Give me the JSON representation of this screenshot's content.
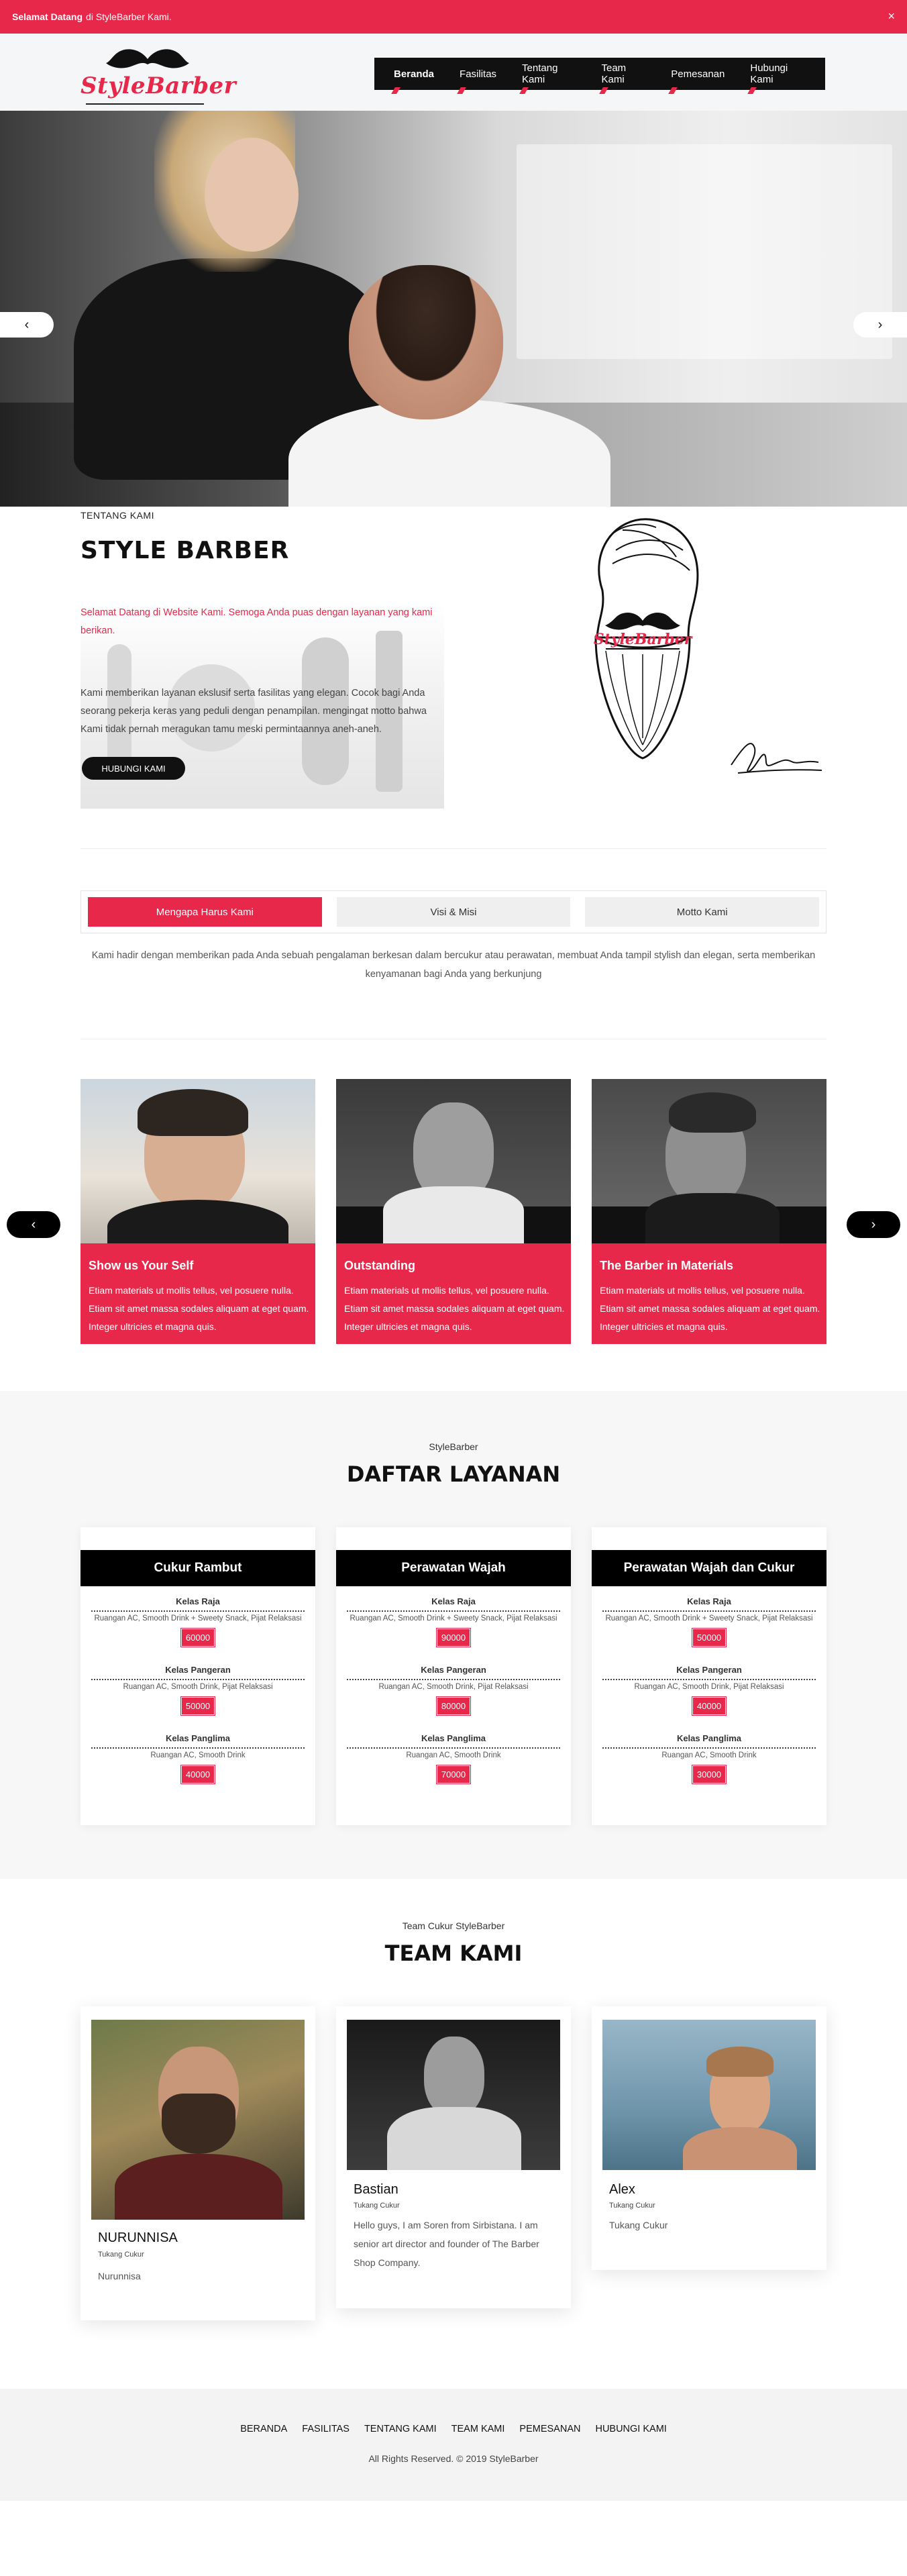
{
  "alert": {
    "strong": "Selamat Datang",
    "text": "di StyleBarber Kami.",
    "close": "×"
  },
  "brand": {
    "name": "StyleBarber"
  },
  "nav": {
    "items": [
      "Beranda",
      "Fasilitas",
      "Tentang Kami",
      "Team Kami",
      "Pemesanan",
      "Hubungi Kami"
    ]
  },
  "hero": {
    "prev": "‹",
    "next": "›"
  },
  "about": {
    "kicker": "TENTANG KAMI",
    "title": "STYLE BARBER",
    "intro": "Selamat Datang di Website Kami. Semoga Anda puas dengan layanan yang kami berikan.",
    "body": "Kami memberikan layanan ekslusif serta fasilitas yang elegan. Cocok bagi Anda seorang pekerja keras yang peduli dengan penampilan. mengingat motto bahwa Kami tidak pernah meragukan tamu meski permintaannya aneh-aneh.",
    "button": "HUBUNGI KAMI",
    "beard_logo": "StyleBarber"
  },
  "tabs": {
    "items": [
      "Mengapa Harus Kami",
      "Visi & Misi",
      "Motto Kami"
    ],
    "active": 0,
    "content": "Kami hadir dengan memberikan pada Anda sebuah pengalaman berkesan dalam bercukur atau perawatan, membuat Anda tampil stylish dan elegan, serta memberikan kenyamanan bagi Anda yang berkunjung"
  },
  "features": {
    "prev": "‹",
    "next": "›",
    "items": [
      {
        "title": "Show us Your Self",
        "text": "Etiam materials ut mollis tellus, vel posuere nulla. Etiam sit amet massa sodales aliquam at eget quam. Integer ultricies et magna quis."
      },
      {
        "title": "Outstanding",
        "text": "Etiam materials ut mollis tellus, vel posuere nulla. Etiam sit amet massa sodales aliquam at eget quam. Integer ultricies et magna quis."
      },
      {
        "title": "The Barber in Materials",
        "text": "Etiam materials ut mollis tellus, vel posuere nulla. Etiam sit amet massa sodales aliquam at eget quam. Integer ultricies et magna quis."
      }
    ]
  },
  "services": {
    "kicker": "StyleBarber",
    "title": "DAFTAR LAYANAN",
    "cards": [
      {
        "title": "Cukur Rambut",
        "tiers": [
          {
            "name": "Kelas Raja",
            "desc": "Ruangan AC, Smooth Drink + Sweety Snack, Pijat Relaksasi",
            "price": "60000"
          },
          {
            "name": "Kelas Pangeran",
            "desc": "Ruangan AC, Smooth Drink, Pijat Relaksasi",
            "price": "50000"
          },
          {
            "name": "Kelas Panglima",
            "desc": "Ruangan AC, Smooth Drink",
            "price": "40000"
          }
        ]
      },
      {
        "title": "Perawatan Wajah",
        "tiers": [
          {
            "name": "Kelas Raja",
            "desc": "Ruangan AC, Smooth Drink + Sweety Snack, Pijat Relaksasi",
            "price": "90000"
          },
          {
            "name": "Kelas Pangeran",
            "desc": "Ruangan AC, Smooth Drink, Pijat Relaksasi",
            "price": "80000"
          },
          {
            "name": "Kelas Panglima",
            "desc": "Ruangan AC, Smooth Drink",
            "price": "70000"
          }
        ]
      },
      {
        "title": "Perawatan Wajah dan Cukur",
        "tiers": [
          {
            "name": "Kelas Raja",
            "desc": "Ruangan AC, Smooth Drink + Sweety Snack, Pijat Relaksasi",
            "price": "50000"
          },
          {
            "name": "Kelas Pangeran",
            "desc": "Ruangan AC, Smooth Drink, Pijat Relaksasi",
            "price": "40000"
          },
          {
            "name": "Kelas Panglima",
            "desc": "Ruangan AC, Smooth Drink",
            "price": "30000"
          }
        ]
      }
    ]
  },
  "team": {
    "kicker": "Team Cukur StyleBarber",
    "title": "TEAM KAMI",
    "members": [
      {
        "name": "NURUNNISA",
        "role": "Tukang Cukur",
        "bio": "Nurunnisa"
      },
      {
        "name": "Bastian",
        "role": "Tukang Cukur",
        "bio": "Hello guys, I am Soren from Sirbistana. I am senior art director and founder of The Barber Shop Company."
      },
      {
        "name": "Alex",
        "role": "Tukang Cukur",
        "bio": "Tukang Cukur"
      }
    ]
  },
  "footer": {
    "links": [
      "BERANDA",
      "FASILITAS",
      "TENTANG KAMI",
      "TEAM KAMI",
      "PEMESANAN",
      "HUBUNGI KAMI"
    ],
    "copyright": "All Rights Reserved. © 2019 StyleBarber"
  },
  "colors": {
    "accent": "#e8284a",
    "dark": "#111111",
    "light_bg": "#f7f7f7"
  }
}
